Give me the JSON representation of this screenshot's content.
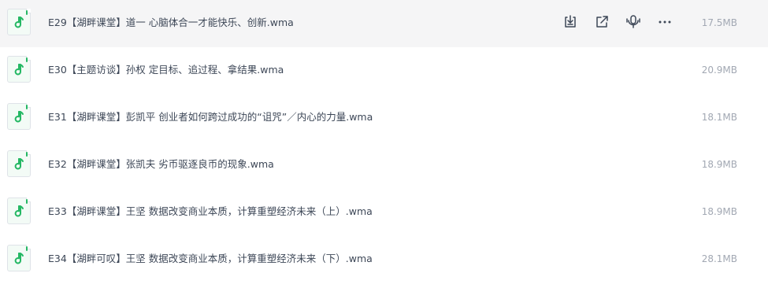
{
  "colors": {
    "accent": "#25b864",
    "text": "#3d4757",
    "size_text": "#a2a8b3",
    "hover_bg": "#f5f5f6"
  },
  "row_actions": [
    {
      "icon": "download-icon"
    },
    {
      "icon": "share-icon"
    },
    {
      "icon": "podcast-icon"
    },
    {
      "icon": "more-icon"
    }
  ],
  "files": [
    {
      "name": "E29【湖畔课堂】道一 心脑体合一才能快乐、创新.wma",
      "size": "17.5MB",
      "icon": "audio-file-icon"
    },
    {
      "name": "E30【主题访谈】孙权 定目标、追过程、拿结果.wma",
      "size": "20.9MB",
      "icon": "audio-file-icon"
    },
    {
      "name": "E31【湖畔课堂】彭凯平 创业者如何跨过成功的“诅咒”／内心的力量.wma",
      "size": "18.1MB",
      "icon": "audio-file-icon"
    },
    {
      "name": "E32【湖畔课堂】张凯夫 劣币驱逐良币的现象.wma",
      "size": "18.9MB",
      "icon": "audio-file-icon"
    },
    {
      "name": "E33【湖畔课堂】王坚 数据改变商业本质，计算重塑经济未来（上）.wma",
      "size": "18.9MB",
      "icon": "audio-file-icon"
    },
    {
      "name": "E34【湖畔可叹】王坚 数据改变商业本质，计算重塑经济未来（下）.wma",
      "size": "28.1MB",
      "icon": "audio-file-icon"
    }
  ]
}
